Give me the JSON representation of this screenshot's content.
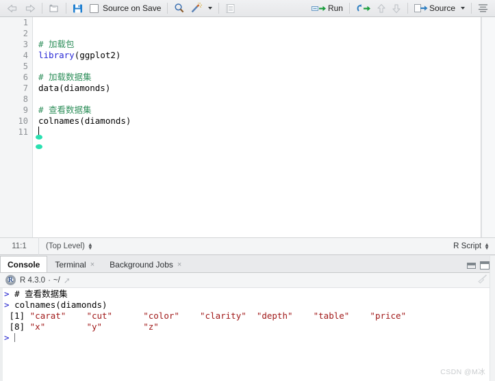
{
  "toolbar": {
    "back_icon": "back-arrow-icon",
    "forward_icon": "forward-arrow-icon",
    "open_icon": "open-file-icon",
    "save_icon": "save-icon",
    "source_on_save_label": "Source on Save",
    "find_icon": "magnifier-icon",
    "magic_icon": "code-tools-wand-icon",
    "compile_report_icon": "compile-report-icon",
    "run_label": "Run",
    "run_icon": "run-icon",
    "rerun_icon": "rerun-previous-icon",
    "up_icon": "go-up-icon",
    "down_icon": "go-down-icon",
    "source_label": "Source",
    "source_icon": "source-icon",
    "outline_icon": "document-outline-icon"
  },
  "editor": {
    "line_numbers": [
      "1",
      "2",
      "3",
      "4",
      "5",
      "6",
      "7",
      "8",
      "9",
      "10",
      "11"
    ],
    "lines": [
      {
        "n": "1",
        "segments": []
      },
      {
        "n": "2",
        "segments": []
      },
      {
        "n": "3",
        "segments": [
          {
            "t": "# 加载包",
            "c": "cm"
          }
        ]
      },
      {
        "n": "4",
        "segments": [
          {
            "t": "library",
            "c": "kw"
          },
          {
            "t": "(ggplot2)",
            "c": "pl"
          }
        ]
      },
      {
        "n": "5",
        "segments": []
      },
      {
        "n": "6",
        "segments": [
          {
            "t": "# 加载数据集",
            "c": "cm"
          }
        ]
      },
      {
        "n": "7",
        "segments": [
          {
            "t": "data(diamonds)",
            "c": "pl"
          }
        ]
      },
      {
        "n": "8",
        "segments": []
      },
      {
        "n": "9",
        "segments": [
          {
            "t": "# 查看数据集",
            "c": "cm"
          }
        ]
      },
      {
        "n": "10",
        "segments": [
          {
            "t": "colnames(diamonds)",
            "c": "pl"
          }
        ]
      },
      {
        "n": "11",
        "segments": []
      }
    ],
    "status": {
      "cursor_position": "11:1",
      "scope": "(Top Level)",
      "doc_type": "R Script"
    }
  },
  "console": {
    "tabs": [
      {
        "label": "Console",
        "closable": false,
        "active": true
      },
      {
        "label": "Terminal",
        "closable": true,
        "active": false
      },
      {
        "label": "Background Jobs",
        "closable": true,
        "active": false
      }
    ],
    "close_glyph": "×",
    "r_version": "R 4.3.0",
    "separator": "·",
    "working_dir": "~/",
    "broom_icon": "clear-console-broom-icon",
    "minimize_icon": "minimize-icon",
    "maximize_icon": "maximize-icon",
    "output_lines": [
      {
        "prompt": "> ",
        "text": "# 查看数据集",
        "kind": "input"
      },
      {
        "prompt": "> ",
        "text": "colnames(diamonds)",
        "kind": "input"
      },
      {
        "prompt": "",
        "index": "[1]",
        "values": [
          "\"carat\"",
          "\"cut\"",
          "\"color\"",
          "\"clarity\"",
          "\"depth\"",
          "\"table\"",
          "\"price\""
        ],
        "kind": "output"
      },
      {
        "prompt": "",
        "index": "[8]",
        "values": [
          "\"x\"",
          "\"y\"",
          "\"z\""
        ],
        "kind": "output"
      },
      {
        "prompt": "> ",
        "text": "",
        "kind": "prompt"
      }
    ]
  },
  "watermark": {
    "text": "CSDN @M冰"
  },
  "colors": {
    "keyword": "#2929d6",
    "comment": "#2f8f5b",
    "string": "#a01818",
    "prompt": "#1b1bcc",
    "accent_green": "#2ae0b0",
    "chrome": "#e9eaec"
  }
}
